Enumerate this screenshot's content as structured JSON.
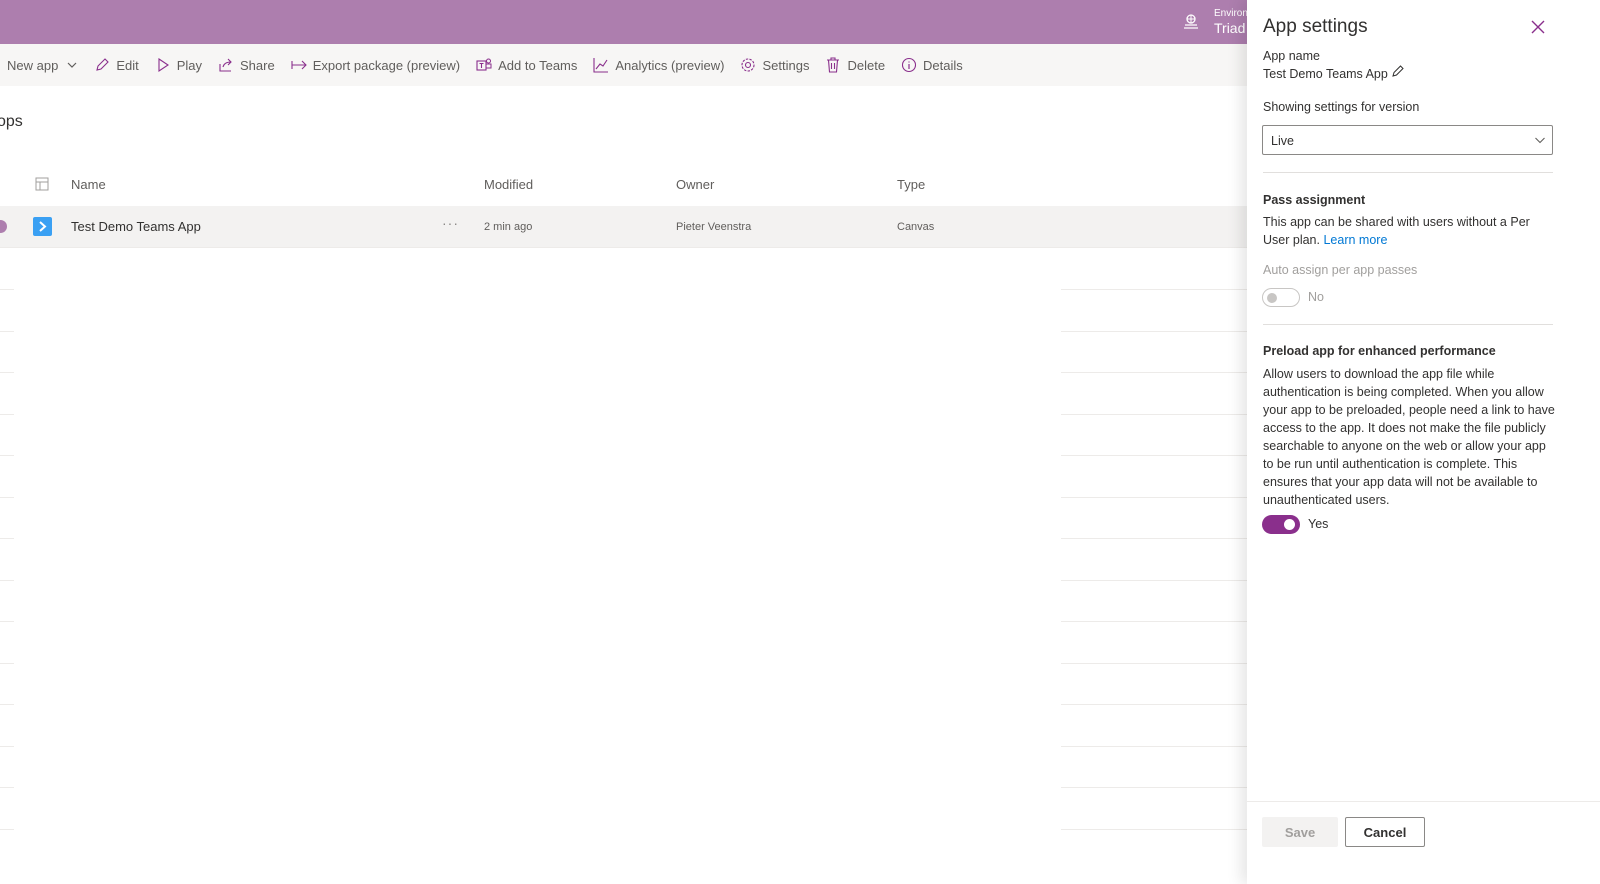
{
  "header": {
    "env_label": "Environ",
    "env_name": "Triad C",
    "env_icon": "environment-icon",
    "bg_color": "#ad7eae"
  },
  "commands": [
    {
      "label": "New app",
      "icon": "plus-icon"
    },
    {
      "label": "Edit",
      "icon": "pencil-icon"
    },
    {
      "label": "Play",
      "icon": "play-icon"
    },
    {
      "label": "Share",
      "icon": "share-icon"
    },
    {
      "label": "Export package (preview)",
      "icon": "export-icon"
    },
    {
      "label": "Add to Teams",
      "icon": "teams-icon"
    },
    {
      "label": "Analytics (preview)",
      "icon": "analytics-icon"
    },
    {
      "label": "Settings",
      "icon": "gear-icon"
    },
    {
      "label": "Delete",
      "icon": "trash-icon"
    },
    {
      "label": "Details",
      "icon": "info-icon"
    }
  ],
  "page": {
    "title": "ops"
  },
  "table": {
    "columns": [
      "Name",
      "Modified",
      "Owner",
      "Type"
    ],
    "rows": [
      {
        "name": "Test Demo Teams App",
        "modified": "2 min ago",
        "owner": "Pieter Veenstra",
        "type": "Canvas",
        "more": "···"
      }
    ]
  },
  "panel": {
    "title": "App settings",
    "app_name_label": "App name",
    "app_name": "Test Demo Teams App",
    "version_label": "Showing settings for version",
    "version_value": "Live",
    "pass": {
      "title": "Pass assignment",
      "text": "This app can be shared with users without a Per User plan.",
      "link": "Learn more",
      "auto_label": "Auto assign per app passes",
      "toggle_text": "No",
      "toggle_on": false
    },
    "preload": {
      "title": "Preload app for enhanced performance",
      "text": "Allow users to download the app file while authentication is being completed. When you allow your app to be preloaded, people need a link to have access to the app. It does not make the file publicly searchable to anyone on the web or allow your app to be run until authentication is complete. This ensures that your app data will not be available to unauthenticated users.",
      "toggle_text": "Yes",
      "toggle_on": true
    },
    "save_label": "Save",
    "cancel_label": "Cancel",
    "accent_color": "#8a2f8c",
    "link_color": "#0078d4"
  }
}
